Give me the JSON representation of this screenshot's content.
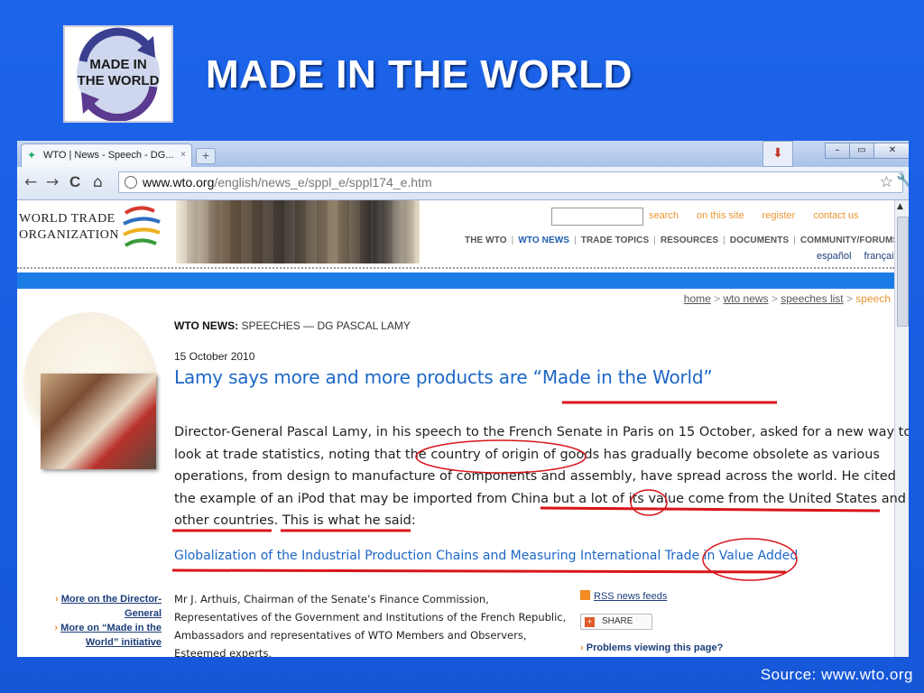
{
  "slide": {
    "title": "MADE IN THE WORLD",
    "logo_text_line1": "MADE IN",
    "logo_text_line2": "THE WORLD",
    "source": "Source:  www.wto.org"
  },
  "browser": {
    "tab_title": "WTO | News - Speech - DG...",
    "tab_close": "×",
    "new_tab": "+",
    "download_icon": "download-arrow-icon",
    "window_controls": [
      "–",
      "▭",
      "✕"
    ],
    "url_domain": "www.wto.org",
    "url_path": "/english/news_e/sppl_e/sppl174_e.htm",
    "back": "←",
    "forward": "→",
    "reload": "C",
    "home": "⌂",
    "star": "☆",
    "wrench": "🔧"
  },
  "wto_header": {
    "logo_line1": "WORLD TRADE",
    "logo_line2": "ORGANIZATION",
    "top_links": [
      "search",
      "on this site",
      "register",
      "contact us"
    ],
    "nav": [
      "THE WTO",
      "WTO NEWS",
      "TRADE TOPICS",
      "RESOURCES",
      "DOCUMENTS",
      "COMMUNITY/FORUMS"
    ],
    "lang": [
      "español",
      "français"
    ]
  },
  "breadcrumb": {
    "items": [
      "home",
      "wto news",
      "speeches list"
    ],
    "current": "speech",
    "sep": " > "
  },
  "article": {
    "section_bold": "WTO NEWS:",
    "section_rest": " SPEECHES — DG PASCAL LAMY",
    "date": "15 October 2010",
    "headline": "Lamy says more and more products are “Made in the World”",
    "paragraph_lines": [
      "Director-General Pascal Lamy, in his speech to the French Senate in Paris on 15 October, asked for a new way to",
      "look at trade statistics, noting that the country of origin of goods has gradually become obsolete as various",
      "operations, from design to manufacture of components and assembly, have spread across the world. He cited",
      "the example of an iPod that may be imported from China but a lot of its value come from the United States and",
      "other countries. This is what he said:"
    ],
    "report_link": "Globalization of the Industrial Production Chains and Measuring International Trade in Value Added",
    "salutation_lines": [
      "Mr J. Arthuis, Chairman of the Senate’s Finance Commission,",
      "Representatives of the Government and Institutions of the French Republic,",
      "Ambassadors and representatives of WTO Members and Observers,",
      "Esteemed experts,"
    ]
  },
  "sidebar": {
    "link1_line1": "More on the Director-",
    "link1_line2": "General",
    "link2_line1": "More on “Made in the",
    "link2_line2": "World” initiative",
    "arrow": "›"
  },
  "right_box": {
    "rss": "RSS news feeds",
    "share": "SHARE",
    "problems": "Problems viewing this page?"
  },
  "colors": {
    "slide_bg": "#1a5fe0",
    "annotation_red": "#d8151b",
    "link_blue": "#1c67c7",
    "wto_orange": "#e8952f"
  }
}
